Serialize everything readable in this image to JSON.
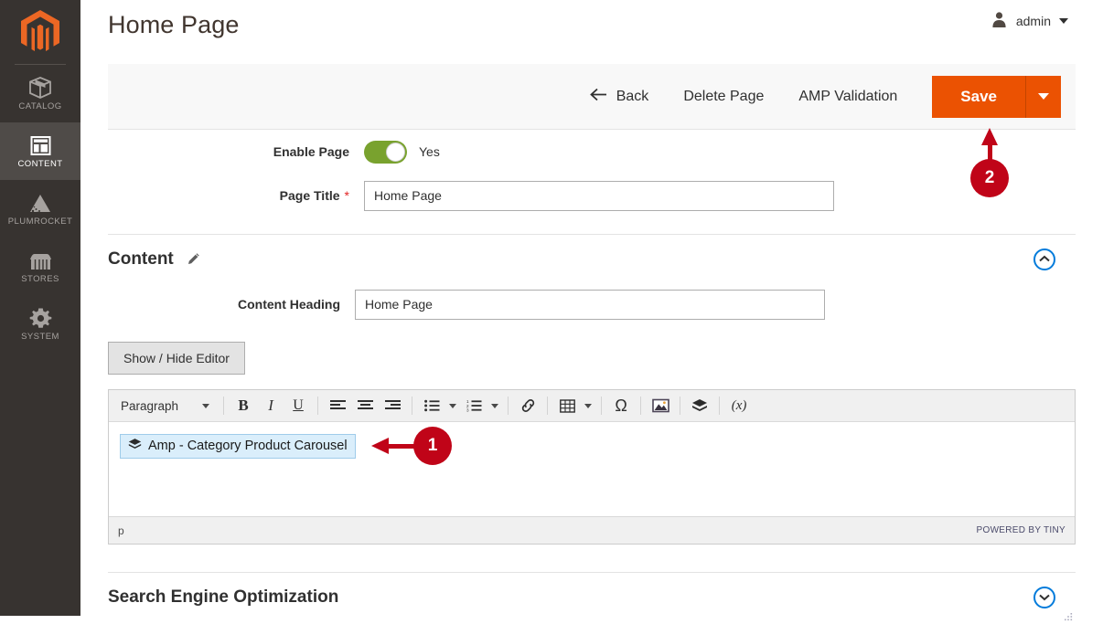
{
  "sidebar": {
    "logo_name": "magento-logo",
    "items": [
      {
        "label": "CATALOG",
        "icon": "box-icon",
        "active": false
      },
      {
        "label": "CONTENT",
        "icon": "layout-icon",
        "active": true
      },
      {
        "label": "PLUMROCKET",
        "icon": "pyramid-icon",
        "active": false
      },
      {
        "label": "STORES",
        "icon": "store-icon",
        "active": false
      },
      {
        "label": "SYSTEM",
        "icon": "gear-icon",
        "active": false
      }
    ]
  },
  "header": {
    "title": "Home Page",
    "user": "admin",
    "user_icon": "user-icon",
    "caret_icon": "chevron-down-icon"
  },
  "action_bar": {
    "back_label": "Back",
    "back_icon": "arrow-left-icon",
    "delete_label": "Delete Page",
    "amp_validation_label": "AMP Validation",
    "save_label": "Save",
    "save_caret_icon": "chevron-down-icon",
    "save_color": "#eb5202"
  },
  "form": {
    "enable_page": {
      "label": "Enable Page",
      "value": "Yes",
      "toggle_on": true,
      "toggle_color": "#79a22e"
    },
    "page_title": {
      "label": "Page Title",
      "required_marker": "*",
      "value": "Home Page",
      "placeholder": ""
    }
  },
  "content_section": {
    "title": "Content",
    "edit_icon": "pencil-icon",
    "collapse_icon": "chevron-up-circle-icon",
    "content_heading": {
      "label": "Content Heading",
      "value": "Home Page",
      "placeholder": ""
    },
    "show_hide_editor_label": "Show / Hide Editor"
  },
  "editor": {
    "format_select": "Paragraph",
    "toolbar": [
      {
        "name": "bold-icon",
        "glyph": "B"
      },
      {
        "name": "italic-icon",
        "glyph": "I"
      },
      {
        "name": "underline-icon",
        "glyph": "U"
      },
      {
        "name": "align-left-icon",
        "glyph": ""
      },
      {
        "name": "align-center-icon",
        "glyph": ""
      },
      {
        "name": "align-right-icon",
        "glyph": ""
      },
      {
        "name": "bullet-list-icon",
        "glyph": ""
      },
      {
        "name": "numbered-list-icon",
        "glyph": ""
      },
      {
        "name": "link-icon",
        "glyph": ""
      },
      {
        "name": "table-icon",
        "glyph": ""
      },
      {
        "name": "special-char-icon",
        "glyph": "Ω"
      },
      {
        "name": "insert-image-icon",
        "glyph": ""
      },
      {
        "name": "insert-widget-icon",
        "glyph": ""
      },
      {
        "name": "insert-variable-icon",
        "glyph": "(x)"
      }
    ],
    "widget_chip": {
      "label": "Amp - Category Product Carousel",
      "icon": "widget-icon"
    },
    "status_path": "p",
    "branding": "POWERED BY TINY",
    "resize_handle": "resize-grip-icon"
  },
  "seo_section": {
    "title": "Search Engine Optimization",
    "expand_icon": "chevron-down-circle-icon"
  },
  "annotations": [
    {
      "number": "1",
      "points_to": "widget-chip",
      "direction": "left"
    },
    {
      "number": "2",
      "points_to": "save-button",
      "direction": "up"
    }
  ]
}
